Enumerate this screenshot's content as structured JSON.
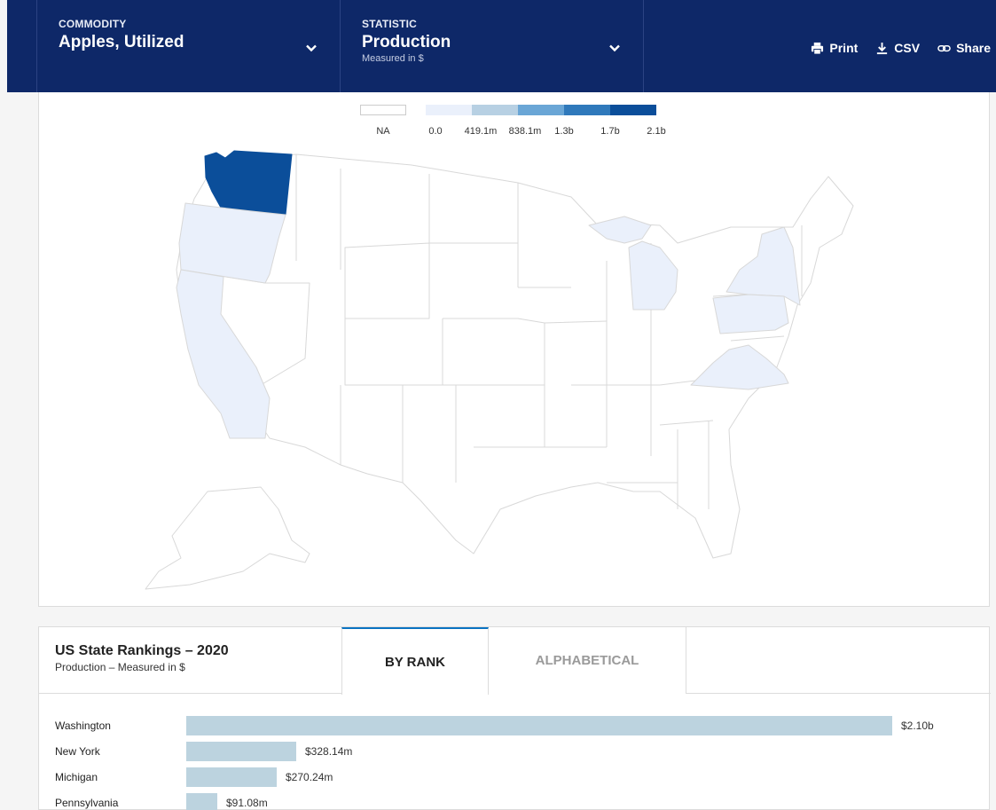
{
  "header": {
    "commodity": {
      "caption": "COMMODITY",
      "value": "Apples, Utilized"
    },
    "statistic": {
      "caption": "STATISTIC",
      "value": "Production",
      "sub": "Measured in $"
    },
    "actions": {
      "print": "Print",
      "csv": "CSV",
      "share": "Share"
    }
  },
  "legend": {
    "na_label": "NA",
    "labels": [
      "0.0",
      "419.1m",
      "838.1m",
      "1.3b",
      "1.7b",
      "2.1b"
    ],
    "colors": {
      "na": "#ffffff",
      "bins": [
        "#eaf0fb",
        "#b7d0e3",
        "#6aa6d6",
        "#2f79bb",
        "#0b4e9a"
      ]
    }
  },
  "map": {
    "colored_states": [
      {
        "state": "Washington",
        "bin": 5,
        "color": "#0b4e9a"
      },
      {
        "state": "Oregon",
        "bin": 1,
        "color": "#eaf0fb"
      },
      {
        "state": "California",
        "bin": 1,
        "color": "#eaf0fb"
      },
      {
        "state": "Michigan",
        "bin": 1,
        "color": "#eaf0fb"
      },
      {
        "state": "New York",
        "bin": 1,
        "color": "#eaf0fb"
      },
      {
        "state": "Pennsylvania",
        "bin": 1,
        "color": "#eaf0fb"
      },
      {
        "state": "Virginia",
        "bin": 1,
        "color": "#eaf0fb"
      }
    ]
  },
  "rankings": {
    "title": "US State Rankings – 2020",
    "subtitle": "Production – Measured in $",
    "tabs": {
      "by_rank": "BY RANK",
      "alphabetical": "ALPHABETICAL"
    },
    "max_value": 2100000000,
    "rows": [
      {
        "state": "Washington",
        "value": 2100000000,
        "label": "$2.10b"
      },
      {
        "state": "New York",
        "value": 328140000,
        "label": "$328.14m"
      },
      {
        "state": "Michigan",
        "value": 270240000,
        "label": "$270.24m"
      },
      {
        "state": "Pennsylvania",
        "value": 91080000,
        "label": "$91.08m"
      }
    ]
  }
}
